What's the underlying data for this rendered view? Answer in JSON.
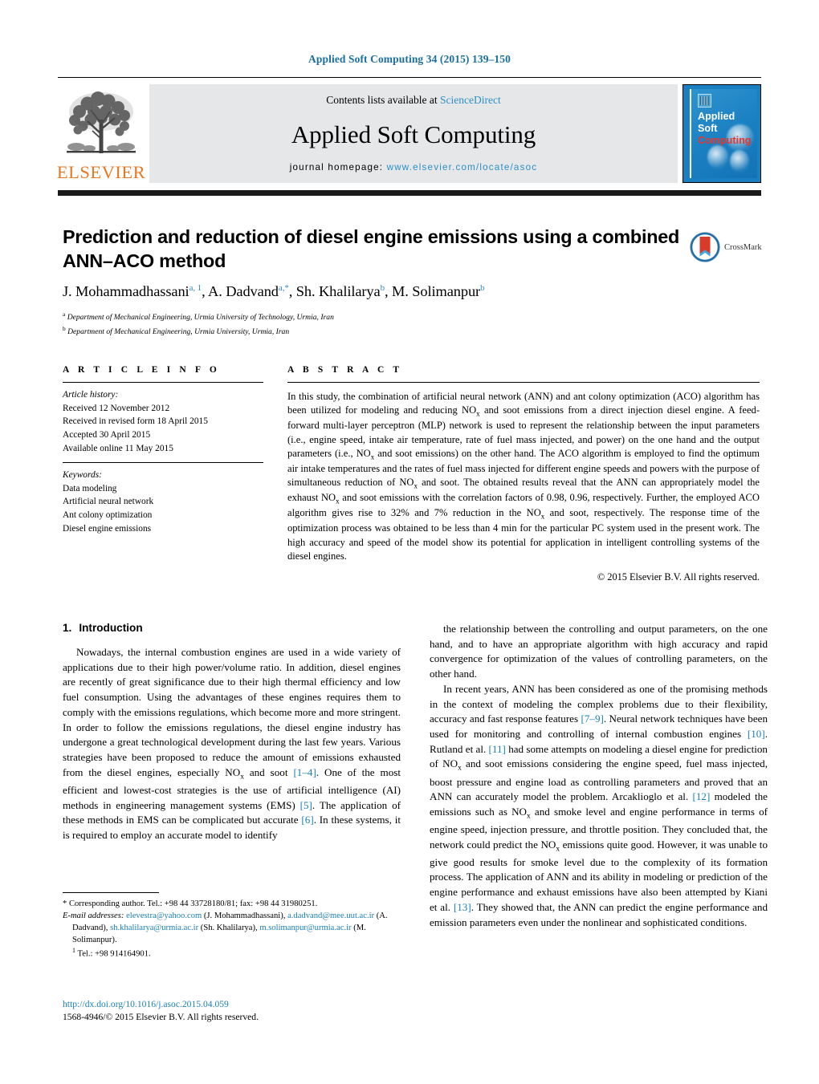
{
  "running_head": "Applied Soft Computing 34 (2015) 139–150",
  "masthead": {
    "publisher_name": "ELSEVIER",
    "contents_prefix": "Contents lists available at ",
    "contents_link": "ScienceDirect",
    "journal_title": "Applied Soft Computing",
    "homepage_label": "journal homepage:",
    "homepage_url": "www.elsevier.com/locate/asoc",
    "cover": {
      "line1": "Applied",
      "line2": "Soft",
      "line3": "Computing"
    }
  },
  "article": {
    "title": "Prediction and reduction of diesel engine emissions using a combined ANN–ACO method",
    "crossmark_label": "CrossMark",
    "authors_html": "J. Mohammadhassani<sup>a, 1</sup>, A. Dadvand<sup>a,</sup><sup class=\"star\">*</sup>, Sh. Khalilarya<sup>b</sup>, M. Solimanpur<sup>b</sup>",
    "affiliations": [
      {
        "marker": "a",
        "text": "Department of Mechanical Engineering, Urmia University of Technology, Urmia, Iran"
      },
      {
        "marker": "b",
        "text": "Department of Mechanical Engineering, Urmia University, Urmia, Iran"
      }
    ]
  },
  "article_info": {
    "heading": "A R T I C L E   I N F O",
    "history_label": "Article history:",
    "history": [
      "Received 12 November 2012",
      "Received in revised form 18 April 2015",
      "Accepted 30 April 2015",
      "Available online 11 May 2015"
    ],
    "keywords_label": "Keywords:",
    "keywords": [
      "Data modeling",
      "Artificial neural network",
      "Ant colony optimization",
      "Diesel engine emissions"
    ]
  },
  "abstract": {
    "heading": "A B S T R A C T",
    "text_html": "In this study, the combination of artificial neural network (ANN) and ant colony optimization (ACO) algorithm has been utilized for modeling and reducing NO<sub>x</sub> and soot emissions from a direct injection diesel engine. A feed-forward multi-layer perceptron (MLP) network is used to represent the relationship between the input parameters (i.e., engine speed, intake air temperature, rate of fuel mass injected, and power) on the one hand and the output parameters (i.e., NO<sub>x</sub> and soot emissions) on the other hand. The ACO algorithm is employed to find the optimum air intake temperatures and the rates of fuel mass injected for different engine speeds and powers with the purpose of simultaneous reduction of NO<sub>x</sub> and soot. The obtained results reveal that the ANN can appropriately model the exhaust NO<sub>x</sub> and soot emissions with the correlation factors of 0.98, 0.96, respectively. Further, the employed ACO algorithm gives rise to 32% and 7% reduction in the NO<sub>x</sub> and soot, respectively. The response time of the optimization process was obtained to be less than 4 min for the particular PC system used in the present work. The high accuracy and speed of the model show its potential for application in intelligent controlling systems of the diesel engines.",
    "copyright": "© 2015 Elsevier B.V. All rights reserved."
  },
  "body": {
    "section_number": "1.",
    "section_title": "Introduction",
    "left_paragraphs_html": [
      "Nowadays, the internal combustion engines are used in a wide variety of applications due to their high power/volume ratio. In addition, diesel engines are recently of great significance due to their high thermal efficiency and low fuel consumption. Using the advantages of these engines requires them to comply with the emissions regulations, which become more and more stringent. In order to follow the emissions regulations, the diesel engine industry has undergone a great technological development during the last few years. Various strategies have been proposed to reduce the amount of emissions exhausted from the diesel engines, especially NO<sub>x</sub> and soot <span class=\"ref\">[1–4]</span>. One of the most efficient and lowest-cost strategies is the use of artificial intelligence (AI) methods in engineering management systems (EMS) <span class=\"ref\">[5]</span>. The application of these methods in EMS can be complicated but accurate <span class=\"ref\">[6]</span>. In these systems, it is required to employ an accurate model to identify"
    ],
    "right_paragraphs_html": [
      "the relationship between the controlling and output parameters, on the one hand, and to have an appropriate algorithm with high accuracy and rapid convergence for optimization of the values of controlling parameters, on the other hand.",
      "In recent years, ANN has been considered as one of the promising methods in the context of modeling the complex problems due to their flexibility, accuracy and fast response features <span class=\"ref\">[7–9]</span>. Neural network techniques have been used for monitoring and controlling of internal combustion engines <span class=\"ref\">[10]</span>. Rutland et al. <span class=\"ref\">[11]</span> had some attempts on modeling a diesel engine for prediction of NO<sub>x</sub> and soot emissions considering the engine speed, fuel mass injected, boost pressure and engine load as controlling parameters and proved that an ANN can accurately model the problem. Arcaklioglo et al. <span class=\"ref\">[12]</span> modeled the emissions such as NO<sub>x</sub> and smoke level and engine performance in terms of engine speed, injection pressure, and throttle position. They concluded that, the network could predict the NO<sub>x</sub> emissions quite good. However, it was unable to give good results for smoke level due to the complexity of its formation process. The application of ANN and its ability in modeling or prediction of the engine performance and exhaust emissions have also been attempted by Kiani et al. <span class=\"ref\">[13]</span>. They showed that, the ANN can predict the engine performance and emission parameters even under the nonlinear and sophisticated conditions."
    ]
  },
  "footnotes": {
    "corresponding_html": "<span class=\"star-mark\">*</span> Corresponding author. Tel.: +98 44 33728180/81; fax: +98 44 31980251.",
    "email_label": "E-mail addresses:",
    "emails_html": "<span class=\"link\">elevestra@yahoo.com</span> (J. Mohammadhassani), <span class=\"link\">a.dadvand@mee.uut.ac.ir</span> (A. Dadvand), <span class=\"link\">sh.khalilarya@urmia.ac.ir</span> (Sh. Khalilarya), <span class=\"link\">m.solimanpur@urmia.ac.ir</span> (M. Solimanpur).",
    "tel_html": "<sup>1</sup> Tel.: +98 914164901."
  },
  "doi_block": {
    "doi_url": "http://dx.doi.org/10.1016/j.asoc.2015.04.059",
    "issn_line": "1568-4946/© 2015 Elsevier B.V. All rights reserved."
  }
}
